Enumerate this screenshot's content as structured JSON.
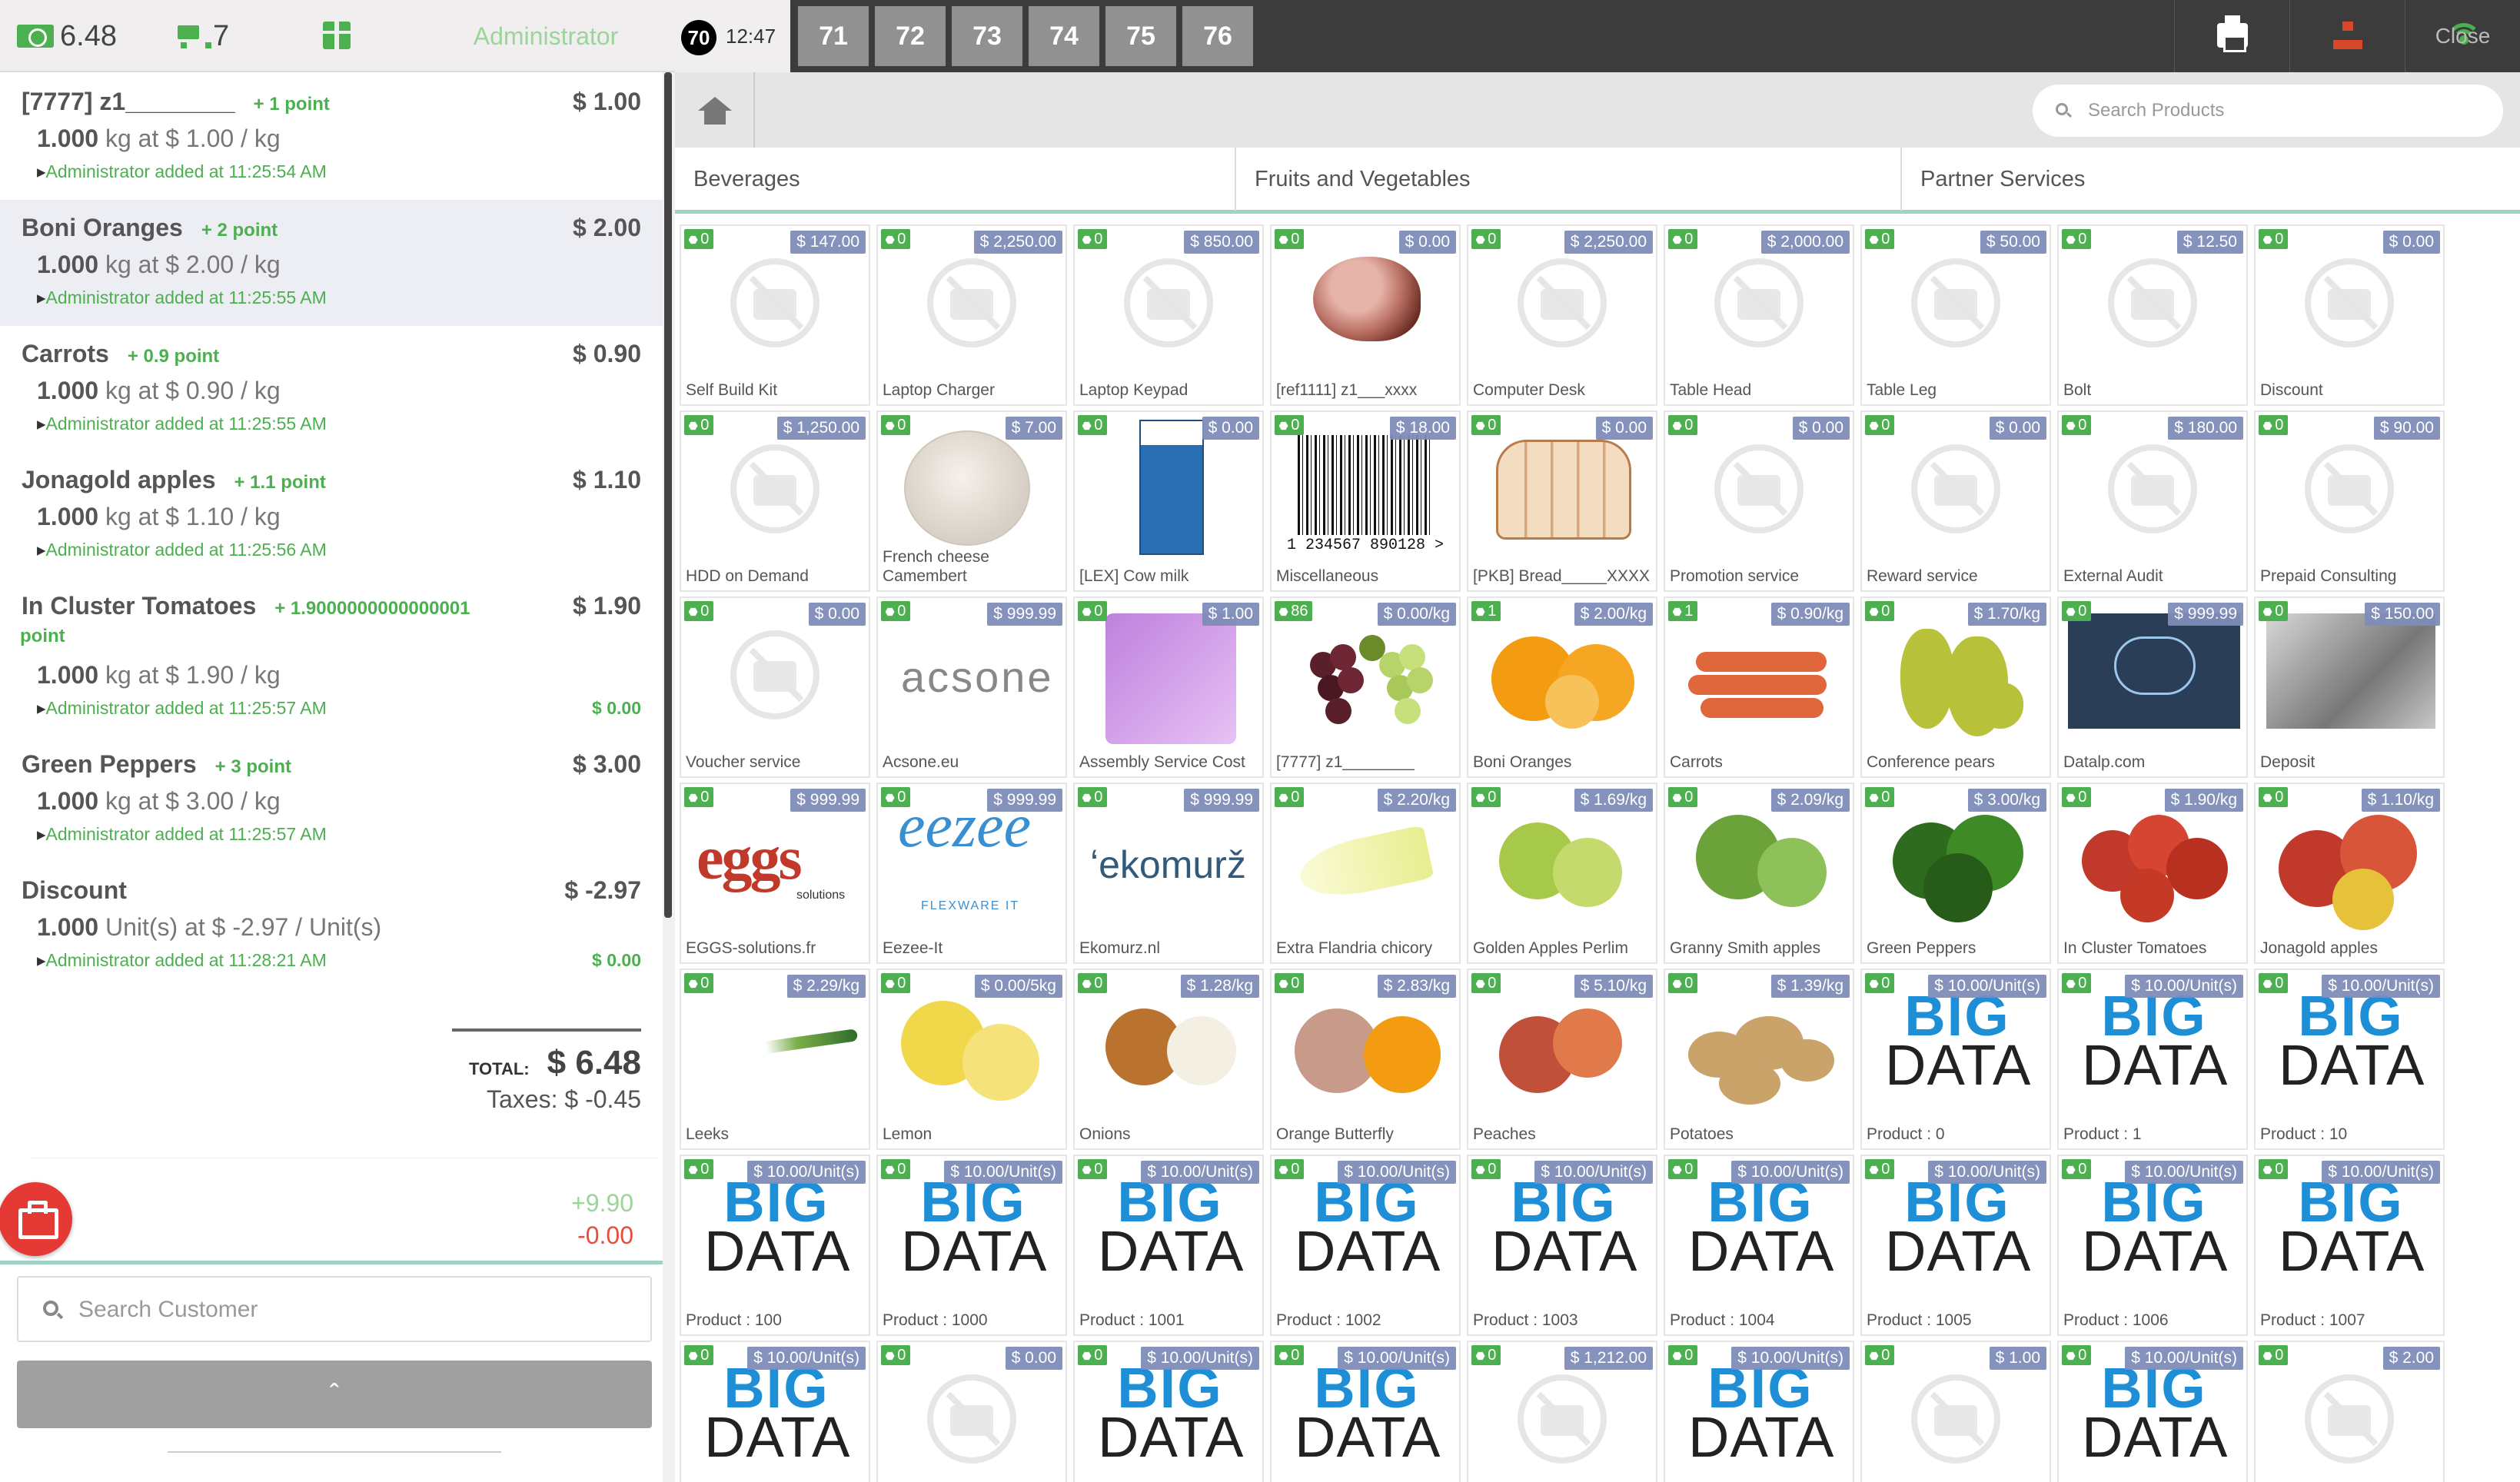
{
  "header_left": {
    "money": "6.48",
    "cart_count": "7",
    "user": "Administrator"
  },
  "orderlines": [
    {
      "name": "[7777] z1________",
      "point": "+ 1 point",
      "price": "$ 1.00",
      "qty": "1.000",
      "unit_text": "kg at $ 1.00 / kg",
      "added": "Administrator added at 11:25:54 AM",
      "discount": "",
      "selected": false
    },
    {
      "name": "Boni Oranges",
      "point": "+ 2 point",
      "price": "$ 2.00",
      "qty": "1.000",
      "unit_text": "kg at $ 2.00 / kg",
      "added": "Administrator added at 11:25:55 AM",
      "discount": "",
      "selected": true
    },
    {
      "name": "Carrots",
      "point": "+ 0.9 point",
      "price": "$ 0.90",
      "qty": "1.000",
      "unit_text": "kg at $ 0.90 / kg",
      "added": "Administrator added at 11:25:55 AM",
      "discount": "",
      "selected": false
    },
    {
      "name": "Jonagold apples",
      "point": "+ 1.1 point",
      "price": "$ 1.10",
      "qty": "1.000",
      "unit_text": "kg at $ 1.10 / kg",
      "added": "Administrator added at 11:25:56 AM",
      "discount": "",
      "selected": false
    },
    {
      "name": "In Cluster Tomatoes",
      "point": "+ 1.9000000000000001",
      "point_wrap": "point",
      "price": "$ 1.90",
      "qty": "1.000",
      "unit_text": "kg at $ 1.90 / kg",
      "added": "Administrator added at 11:25:57 AM",
      "discount": "$ 0.00",
      "selected": false
    },
    {
      "name": "Green Peppers",
      "point": "+ 3 point",
      "price": "$ 3.00",
      "qty": "1.000",
      "unit_text": "kg at $ 3.00 / kg",
      "added": "Administrator added at 11:25:57 AM",
      "discount": "",
      "selected": false
    },
    {
      "name": "Discount",
      "point": "",
      "price": "$ -2.97",
      "qty": "1.000",
      "unit_text": "Unit(s) at $ -2.97 / Unit(s)",
      "added": "Administrator added at 11:28:21 AM",
      "discount": "$ 0.00",
      "selected": false
    }
  ],
  "totals": {
    "total_label": "TOTAL:",
    "total": "$ 6.48",
    "taxes": "Taxes: $ -0.45"
  },
  "points": {
    "plus": "+9.90",
    "minus": "-0.00"
  },
  "customer_search": {
    "placeholder": "Search Customer"
  },
  "expand_label": "ˆ",
  "topbar": {
    "current_order": "70",
    "time": "12:47",
    "orders": [
      "71",
      "72",
      "73",
      "74",
      "75",
      "76"
    ],
    "close": "Close"
  },
  "product_search": {
    "placeholder": "Search Products"
  },
  "categories": [
    "Beverages",
    "Fruits and Vegetables",
    "Partner Services"
  ],
  "products": [
    {
      "name": "Self Build Kit",
      "tag": "0",
      "price": "$ 147.00",
      "img": "placeholder"
    },
    {
      "name": "Laptop Charger",
      "tag": "0",
      "price": "$ 2,250.00",
      "img": "placeholder"
    },
    {
      "name": "Laptop Keypad",
      "tag": "0",
      "price": "$ 850.00",
      "img": "placeholder"
    },
    {
      "name": "[ref1111] z1___xxxx",
      "tag": "0",
      "price": "$ 0.00",
      "img": "ham"
    },
    {
      "name": "Computer Desk",
      "tag": "0",
      "price": "$ 2,250.00",
      "img": "placeholder"
    },
    {
      "name": "Table Head",
      "tag": "0",
      "price": "$ 2,000.00",
      "img": "placeholder"
    },
    {
      "name": "Table Leg",
      "tag": "0",
      "price": "$ 50.00",
      "img": "placeholder"
    },
    {
      "name": "Bolt",
      "tag": "0",
      "price": "$ 12.50",
      "img": "placeholder"
    },
    {
      "name": "Discount",
      "tag": "0",
      "price": "$ 0.00",
      "img": "placeholder"
    },
    {
      "name": "HDD on Demand",
      "tag": "0",
      "price": "$ 1,250.00",
      "img": "placeholder"
    },
    {
      "name": "French cheese Camembert",
      "tag": "0",
      "price": "$ 7.00",
      "img": "cheese"
    },
    {
      "name": "[LEX] Cow milk",
      "tag": "0",
      "price": "$ 0.00",
      "img": "milk"
    },
    {
      "name": "Miscellaneous",
      "tag": "0",
      "price": "$ 18.00",
      "img": "barcode",
      "barcode_text": "1  234567  890128  >"
    },
    {
      "name": "[PKB] Bread_____XXXX",
      "tag": "0",
      "price": "$ 0.00",
      "img": "bread"
    },
    {
      "name": "Promotion service",
      "tag": "0",
      "price": "$ 0.00",
      "img": "placeholder"
    },
    {
      "name": "Reward service",
      "tag": "0",
      "price": "$ 0.00",
      "img": "placeholder"
    },
    {
      "name": "External Audit",
      "tag": "0",
      "price": "$ 180.00",
      "img": "placeholder"
    },
    {
      "name": "Prepaid Consulting",
      "tag": "0",
      "price": "$ 90.00",
      "img": "placeholder"
    },
    {
      "name": "Voucher service",
      "tag": "0",
      "price": "$ 0.00",
      "img": "placeholder"
    },
    {
      "name": "Acsone.eu",
      "tag": "0",
      "price": "$ 999.99",
      "img": "acsone",
      "logo": "acsone"
    },
    {
      "name": "Assembly Service Cost",
      "tag": "0",
      "price": "$ 1.00",
      "img": "puzzle"
    },
    {
      "name": "[7777] z1________",
      "tag": "86",
      "price": "$ 0.00/kg",
      "img": "grapes"
    },
    {
      "name": "Boni Oranges",
      "tag": "1",
      "price": "$ 2.00/kg",
      "img": "oranges"
    },
    {
      "name": "Carrots",
      "tag": "1",
      "price": "$ 0.90/kg",
      "img": "carrots"
    },
    {
      "name": "Conference pears",
      "tag": "0",
      "price": "$ 1.70/kg",
      "img": "pears"
    },
    {
      "name": "Datalp.com",
      "tag": "0",
      "price": "$ 999.99",
      "img": "data"
    },
    {
      "name": "Deposit",
      "tag": "0",
      "price": "$ 150.00",
      "img": "deposit"
    },
    {
      "name": "EGGS-solutions.fr",
      "tag": "0",
      "price": "$ 999.99",
      "img": "eggs",
      "logo": "eggs",
      "logo_sub": "solutions"
    },
    {
      "name": "Eezee-It",
      "tag": "0",
      "price": "$ 999.99",
      "img": "eezee",
      "logo": "eezee",
      "logo_sub": "FLEXWARE IT"
    },
    {
      "name": "Ekomurz.nl",
      "tag": "0",
      "price": "$ 999.99",
      "img": "ekomurz",
      "logo": "ʻekomurž"
    },
    {
      "name": "Extra Flandria chicory",
      "tag": "0",
      "price": "$ 2.20/kg",
      "img": "endive"
    },
    {
      "name": "Golden Apples Perlim",
      "tag": "0",
      "price": "$ 1.69/kg",
      "img": "golden"
    },
    {
      "name": "Granny Smith apples",
      "tag": "0",
      "price": "$ 2.09/kg",
      "img": "granny"
    },
    {
      "name": "Green Peppers",
      "tag": "0",
      "price": "$ 3.00/kg",
      "img": "peppers"
    },
    {
      "name": "In Cluster Tomatoes",
      "tag": "0",
      "price": "$ 1.90/kg",
      "img": "tomatoes"
    },
    {
      "name": "Jonagold apples",
      "tag": "0",
      "price": "$ 1.10/kg",
      "img": "jonagold"
    },
    {
      "name": "Leeks",
      "tag": "0",
      "price": "$ 2.29/kg",
      "img": "leek"
    },
    {
      "name": "Lemon",
      "tag": "0",
      "price": "$ 0.00/5kg",
      "img": "lemon"
    },
    {
      "name": "Onions",
      "tag": "0",
      "price": "$ 1.28/kg",
      "img": "onions"
    },
    {
      "name": "Orange Butterfly",
      "tag": "0",
      "price": "$ 2.83/kg",
      "img": "orangeb"
    },
    {
      "name": "Peaches",
      "tag": "0",
      "price": "$ 5.10/kg",
      "img": "peaches"
    },
    {
      "name": "Potatoes",
      "tag": "0",
      "price": "$ 1.39/kg",
      "img": "potatoes"
    },
    {
      "name": "Product : 0",
      "tag": "0",
      "price": "$ 10.00/Unit(s)",
      "img": "bigdata"
    },
    {
      "name": "Product : 1",
      "tag": "0",
      "price": "$ 10.00/Unit(s)",
      "img": "bigdata"
    },
    {
      "name": "Product : 10",
      "tag": "0",
      "price": "$ 10.00/Unit(s)",
      "img": "bigdata"
    },
    {
      "name": "Product : 100",
      "tag": "0",
      "price": "$ 10.00/Unit(s)",
      "img": "bigdata"
    },
    {
      "name": "Product : 1000",
      "tag": "0",
      "price": "$ 10.00/Unit(s)",
      "img": "bigdata"
    },
    {
      "name": "Product : 1001",
      "tag": "0",
      "price": "$ 10.00/Unit(s)",
      "img": "bigdata"
    },
    {
      "name": "Product : 1002",
      "tag": "0",
      "price": "$ 10.00/Unit(s)",
      "img": "bigdata"
    },
    {
      "name": "Product : 1003",
      "tag": "0",
      "price": "$ 10.00/Unit(s)",
      "img": "bigdata"
    },
    {
      "name": "Product : 1004",
      "tag": "0",
      "price": "$ 10.00/Unit(s)",
      "img": "bigdata"
    },
    {
      "name": "Product : 1005",
      "tag": "0",
      "price": "$ 10.00/Unit(s)",
      "img": "bigdata"
    },
    {
      "name": "Product : 1006",
      "tag": "0",
      "price": "$ 10.00/Unit(s)",
      "img": "bigdata"
    },
    {
      "name": "Product : 1007",
      "tag": "0",
      "price": "$ 10.00/Unit(s)",
      "img": "bigdata"
    },
    {
      "name": "",
      "tag": "0",
      "price": "$ 10.00/Unit(s)",
      "img": "bigdata"
    },
    {
      "name": "",
      "tag": "0",
      "price": "$ 0.00",
      "img": "placeholder"
    },
    {
      "name": "",
      "tag": "0",
      "price": "$ 10.00/Unit(s)",
      "img": "bigdata"
    },
    {
      "name": "",
      "tag": "0",
      "price": "$ 10.00/Unit(s)",
      "img": "bigdata"
    },
    {
      "name": "",
      "tag": "0",
      "price": "$ 1,212.00",
      "img": "placeholder"
    },
    {
      "name": "",
      "tag": "0",
      "price": "$ 10.00/Unit(s)",
      "img": "bigdata"
    },
    {
      "name": "",
      "tag": "0",
      "price": "$ 1.00",
      "img": "placeholder"
    },
    {
      "name": "",
      "tag": "0",
      "price": "$ 10.00/Unit(s)",
      "img": "bigdata"
    },
    {
      "name": "",
      "tag": "0",
      "price": "$ 2.00",
      "img": "placeholder"
    }
  ],
  "bigdata_logo": {
    "big": "BIG",
    "data": "DATA"
  },
  "colors": {
    "green": "#4caf50",
    "price_badge": "#7f8db8",
    "topbar": "#3c3c3c",
    "order_tab": "#919191",
    "accent_line": "#9fd3c7",
    "fab": "#e53935"
  }
}
